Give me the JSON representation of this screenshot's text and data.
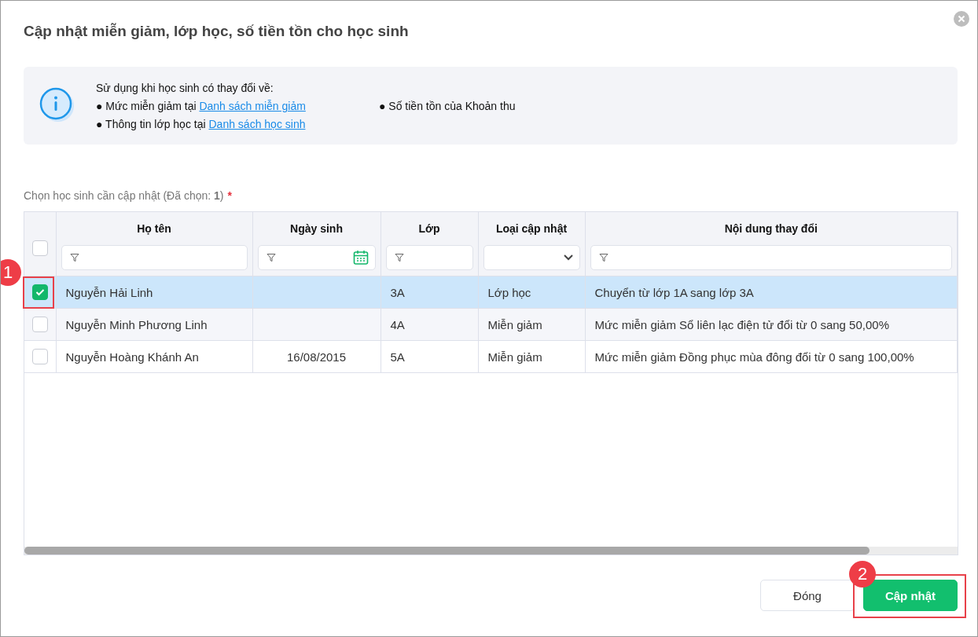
{
  "dialog": {
    "title": "Cập nhật miễn giảm, lớp học, số tiền tồn cho học sinh"
  },
  "info": {
    "intro": "Sử dụng khi học sinh có thay đổi về:",
    "bullets": [
      {
        "marker": "●",
        "text": "Mức miễn giảm tại ",
        "link": "Danh sách miễn giảm"
      },
      {
        "marker": "●",
        "text": "Số tiền tồn của Khoản thu"
      },
      {
        "marker": "●",
        "text": "Thông tin lớp học tại ",
        "link": "Danh sách học sinh"
      }
    ]
  },
  "selection_label": {
    "text": "Chọn học sinh cần cập nhật (Đã chọn: **1**)",
    "required_mark": "*"
  },
  "table": {
    "select_all_checked": false,
    "columns": [
      {
        "label": "Họ tên",
        "kind": "text"
      },
      {
        "label": "Ngày sinh",
        "kind": "date"
      },
      {
        "label": "Lớp",
        "kind": "text"
      },
      {
        "label": "Loại cập nhật",
        "kind": "select"
      },
      {
        "label": "Nội dung thay đổi",
        "kind": "text"
      }
    ],
    "rows": [
      {
        "selected": true,
        "annotation": "1",
        "cells": [
          "Nguyễn Hải Linh",
          "",
          "3A",
          "Lớp học",
          "Chuyển từ lớp 1A sang lớp 3A"
        ]
      },
      {
        "selected": false,
        "cells": [
          "Nguyễn Minh Phương Linh",
          "",
          "4A",
          "Miễn giảm",
          "Mức miễn giảm Sổ liên lạc điện tử đổi từ 0 sang 50,00%"
        ]
      },
      {
        "selected": false,
        "cells": [
          "Nguyễn Hoàng Khánh An",
          "16/08/2015",
          "5A",
          "Miễn giảm",
          "Mức miễn giảm Đồng phục mùa đông đổi từ 0 sang 100,00%"
        ]
      }
    ]
  },
  "buttons": [
    {
      "label": "Đóng",
      "kind": "secondary"
    },
    {
      "label": "Cập nhật",
      "kind": "primary",
      "annotation": "2"
    }
  ]
}
